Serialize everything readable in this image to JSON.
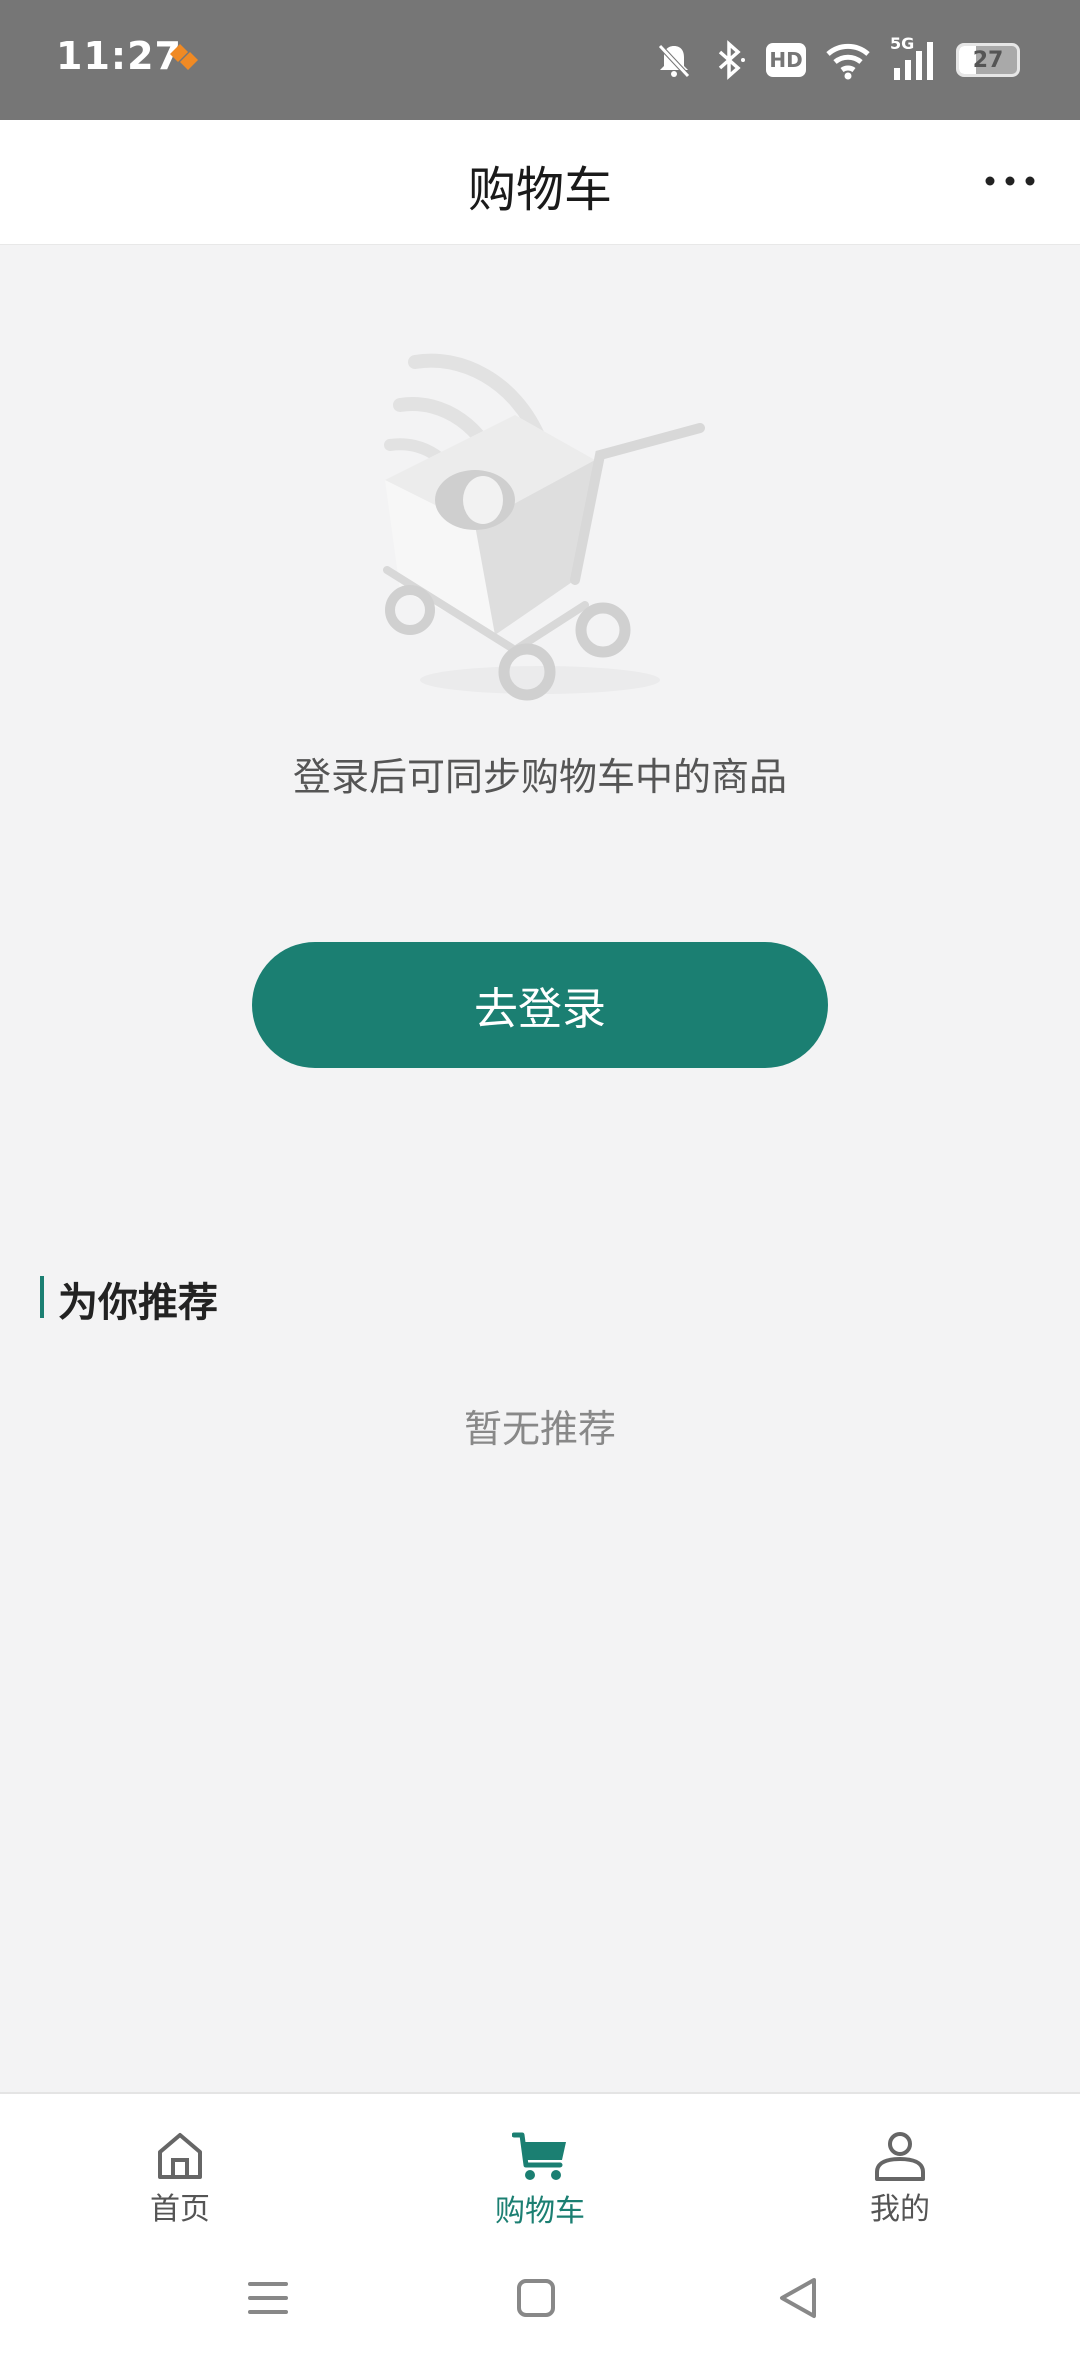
{
  "status_bar": {
    "time": "11:27",
    "battery": "27",
    "network": "5G",
    "hd": "HD"
  },
  "header": {
    "title": "购物车"
  },
  "empty_cart": {
    "message": "登录后可同步购物车中的商品",
    "login_button": "去登录"
  },
  "recommend": {
    "title": "为你推荐",
    "empty_text": "暂无推荐"
  },
  "tabbar": {
    "items": [
      {
        "label": "首页",
        "icon": "home-icon",
        "active": false
      },
      {
        "label": "购物车",
        "icon": "cart-icon",
        "active": true
      },
      {
        "label": "我的",
        "icon": "user-icon",
        "active": false
      }
    ]
  },
  "colors": {
    "accent": "#1b7f72",
    "background": "#f3f3f4",
    "statusbar": "#767676"
  }
}
